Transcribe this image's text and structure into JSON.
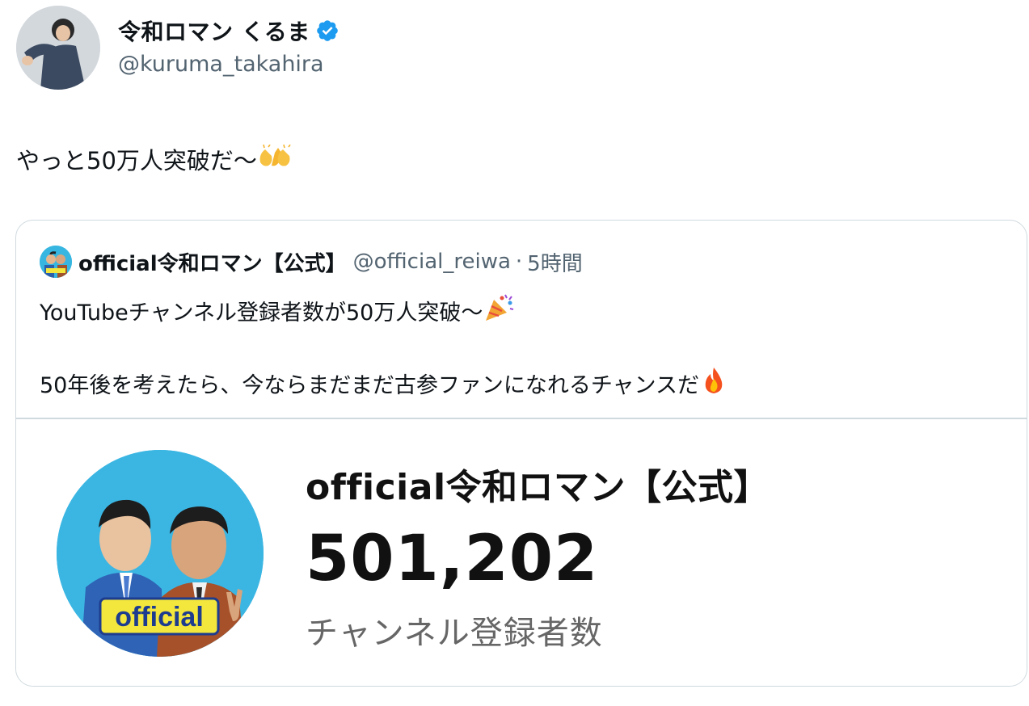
{
  "author": {
    "name": "令和ロマン くるま",
    "handle": "@kuruma_takahira",
    "verified": true
  },
  "tweet": {
    "text": "やっと50万人突破だ〜",
    "emoji": "clapping-hands-emoji"
  },
  "quote": {
    "name": "official令和ロマン【公式】",
    "handle": "@official_reiwa",
    "separator": "·",
    "time": "5時間",
    "line1": "YouTubeチャンネル登録者数が50万人突破〜",
    "line1_emoji": "party-popper-emoji",
    "line2": "50年後を考えたら、今ならまだまだ古参ファンになれるチャンスだ",
    "line2_emoji": "fire-emoji",
    "media": {
      "channel_title": "official令和ロマン【公式】",
      "subscriber_count": "501,202",
      "subscriber_label": "チャンネル登録者数",
      "avatar_badge": "official"
    }
  },
  "colors": {
    "text_primary": "#0f1419",
    "text_secondary": "#536471",
    "border": "#cfd9de",
    "verified_blue": "#1d9bf0"
  }
}
